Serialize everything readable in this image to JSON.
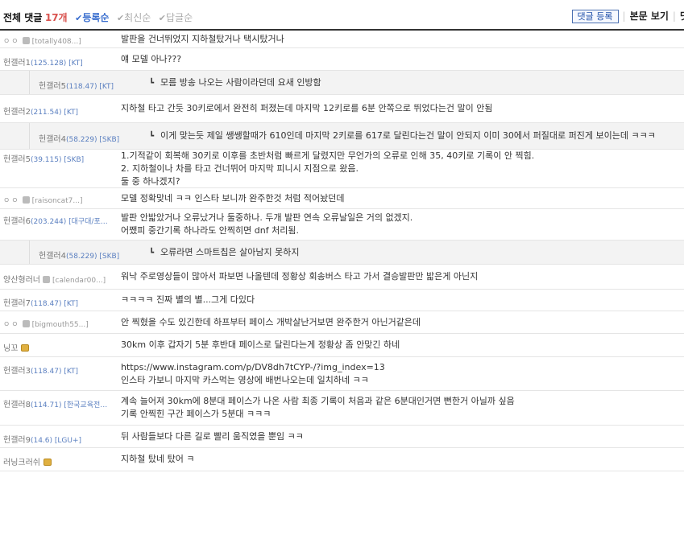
{
  "header": {
    "title": "전체 댓글",
    "count": "17개",
    "sorts": [
      {
        "label": "등록순",
        "active": true
      },
      {
        "label": "최신순",
        "active": false
      },
      {
        "label": "답글순",
        "active": false
      }
    ],
    "register_label": "댓글 등록",
    "view_label": "본문 보기",
    "more_label": "댓"
  },
  "comments": [
    {
      "type": "comment",
      "author": "ㅇㅇ",
      "ip": "[totally408...]",
      "lines": [
        "발판을 건너뛰었지 지하철탔거나 택시탔거나"
      ]
    },
    {
      "type": "comment",
      "author": "헌갤러1",
      "ip": "(125.128) [KT]",
      "lines": [
        "얘 모델 아나???"
      ]
    },
    {
      "type": "reply",
      "author": "헌갤러5",
      "ip": "(118.47) [KT]",
      "lines": [
        "모름 방송 나오는 사람이라던데 요새 인방함"
      ]
    },
    {
      "type": "comment",
      "author": "헌갤러2",
      "ip": "(211.54) [KT]",
      "lines": [
        "지하철 타고 간듯 30키로에서 완전히 퍼졌는데 마지막 12키로를 6분 안쪽으로 뛰었다는건 말이 안됨"
      ]
    },
    {
      "type": "reply",
      "author": "헌갤러4",
      "ip": "(58.229) [SKB]",
      "lines": [
        "이게 맞는듯 제일 쌩쌩할때가 610인데 마지막 2키로를 617로 달린다는건 말이 안되지 이미 30에서 퍼질대로 퍼진게 보이는데 ㅋㅋㅋ"
      ]
    },
    {
      "type": "comment",
      "author": "헌갤러5",
      "ip": "(39.115) [SKB]",
      "lines": [
        "1.기적같이 회복해 30키로 이후를 초반처럼 빠르게 달렸지만 무언가의 오류로 인해 35, 40키로 기록이 안 찍힘.",
        "2. 지하철이나 차를 타고 건너뛰어 마지막 피니시 지점으로 왔음.",
        "둘 중 하나겠지?"
      ]
    },
    {
      "type": "comment",
      "author": "ㅇㅇ",
      "ip": "[raisoncat7...]",
      "lines": [
        "모델 정확맞네 ㅋㅋ 인스타 보니까 완주한것 처럼 적어놨던데"
      ]
    },
    {
      "type": "comment",
      "author": "헌갤러6",
      "ip": "(203.244) [대구대/포…",
      "lines": [
        "발판 안밟았거나 오류났거나 둘중하나. 두개 발판 연속 오류날일은 거의 없겠지.",
        "어쨌피 중간기록 하나라도 안찍히면 dnf 처리됨."
      ]
    },
    {
      "type": "reply",
      "author": "헌갤러4",
      "ip": "(58.229) [SKB]",
      "lines": [
        "오류라면 스마트칩은 살아남지 못하지"
      ]
    },
    {
      "type": "comment",
      "author": "양산형러너",
      "ip": "[calendar00...]",
      "lines": [
        "워낙 주로영상들이 많아서 파보면 나올텐데 정황상 회송버스 타고 가서 결승발판만 밟은게 아닌지"
      ]
    },
    {
      "type": "comment",
      "author": "헌갤러7",
      "ip": "(118.47) [KT]",
      "lines": [
        "ㅋㅋㅋㅋ 진짜 별의 별...그게 다있다"
      ]
    },
    {
      "type": "comment",
      "author": "ㅇㅇ",
      "ip": "[bigmouth55...]",
      "lines": [
        "안 찍혔을 수도 있긴한데 하프부터 페이스 개박살난거보면 완주한거 아닌거같은데"
      ]
    },
    {
      "type": "comment",
      "author": "닝꼬",
      "ip": "",
      "lines": [
        "30km 이후 갑자기 5분 후반대 페이스로 달린다는게 정황상 좀 안맞긴 하네"
      ]
    },
    {
      "type": "comment",
      "author": "헌갤러3",
      "ip": "(118.47) [KT]",
      "lines": [
        "https://www.instagram.com/p/DV8dh7tCYP-/?img_index=13",
        "인스타 가보니 마지막 카스먹는 영상에 배번나오는데 일치하네 ㅋㅋ"
      ]
    },
    {
      "type": "comment",
      "author": "헌갤러8",
      "ip": "(114.71) [한국교육전…",
      "lines": [
        "계속 늘어져 30km에 8분대 페이스가 나온 사람 최종 기록이 처음과 같은 6분대인거면 뻔한거 아닐까 싶음",
        "기록 안찍힌 구간 페이스가 5분대 ㅋㅋㅋ"
      ]
    },
    {
      "type": "comment",
      "author": "헌갤러9",
      "ip": "(14.6) [LGU+]",
      "lines": [
        "뒤 사람들보다 다른 길로 빨리 움직였을 뿐임 ㅋㅋ"
      ]
    },
    {
      "type": "comment",
      "author": "러닝크러쉬",
      "ip": "",
      "lines": [
        "지하철 탔네 탔어 ㅋ"
      ]
    }
  ]
}
